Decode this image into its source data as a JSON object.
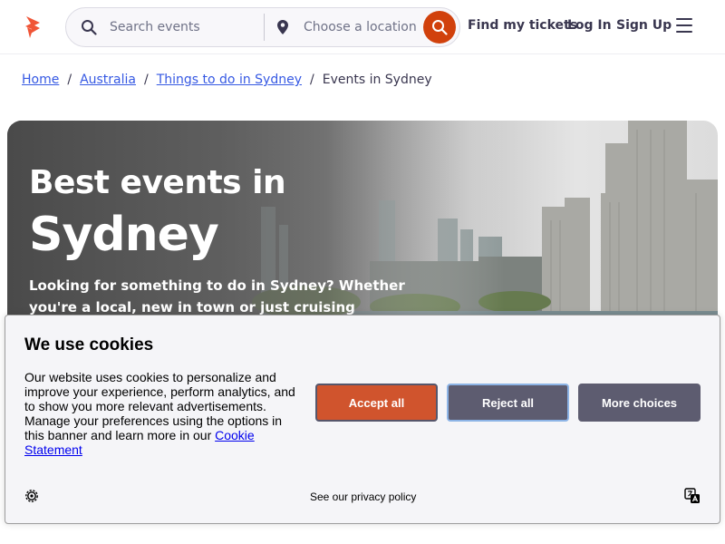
{
  "header": {
    "search": {
      "placeholder": "Search events",
      "icon": "search-icon"
    },
    "location": {
      "placeholder": "Choose a location",
      "icon": "location-pin-icon"
    },
    "search_button_icon": "search-icon",
    "links": {
      "tickets": "Find my tickets",
      "login": "Log In",
      "signup": "Sign Up"
    },
    "brand_color": "#d1410c"
  },
  "breadcrumb": {
    "items": [
      "Home",
      "Australia",
      "Things to do in Sydney"
    ],
    "separator": "/",
    "current": "Events in Sydney"
  },
  "hero": {
    "title_line1": "Best events in",
    "title_line2": "Sydney",
    "description": "Looking for something to do in Sydney? Whether you're a local, new in town or just cruising through we've got loads"
  },
  "cookie_banner": {
    "title": "We use cookies",
    "body": "Our website uses cookies to personalize and improve your experience, perform analytics, and to show you more relevant advertisements. Manage your preferences using the options in this banner and learn more in our ",
    "link_text": "Cookie Statement",
    "buttons": {
      "accept": "Accept all",
      "reject": "Reject all",
      "more": "More choices"
    },
    "privacy_link": "See our privacy policy",
    "accent_color": "#d0542d"
  }
}
